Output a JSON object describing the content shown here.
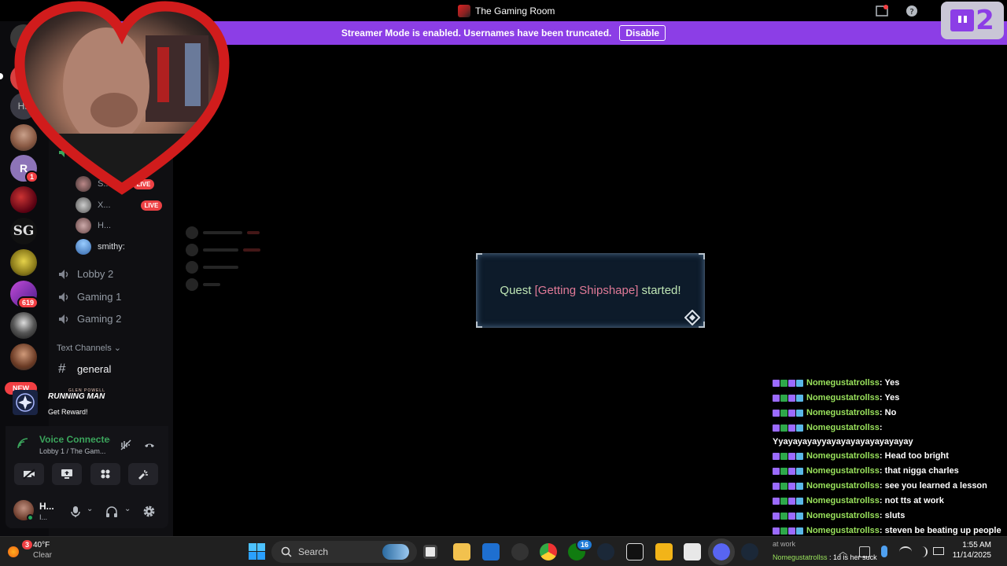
{
  "window": {
    "title": "The Gaming Room"
  },
  "banner": {
    "text": "Streamer Mode is enabled. Usernames have been truncated.",
    "button": "Disable"
  },
  "twitch_badge": {
    "count": "2"
  },
  "guilds": [
    {
      "label": "Hs",
      "icon": "guild-initials"
    },
    {
      "label": "1",
      "icon": "guild-r"
    },
    {
      "label": "SG",
      "icon": "guild-sg"
    },
    {
      "label": "619",
      "icon": "guild-619"
    },
    {
      "label": "NEW",
      "icon": "new-badge"
    }
  ],
  "voice_users": [
    {
      "name": "S...",
      "live": "LIVE"
    },
    {
      "name": "X...",
      "live": "LIVE"
    },
    {
      "name": "H..."
    },
    {
      "name": "smithy:"
    }
  ],
  "channels": {
    "voice": [
      "Lobby 2",
      "Gaming 1",
      "Gaming 2"
    ],
    "text_category": "Text Channels",
    "text": [
      "general"
    ]
  },
  "promo": {
    "title": "RUNNING MAN",
    "subtitle": "GLEN POWELL",
    "cta": "Get Reward!"
  },
  "voice_panel": {
    "status": "Voice Connected",
    "location": "Lobby 1 / The Gam..."
  },
  "user_panel": {
    "name": "H...",
    "status": "I..."
  },
  "quest": {
    "prefix": "Quest ",
    "name": "[Getting Shipshape]",
    "suffix": " started!"
  },
  "chat": {
    "messages": [
      {
        "user": "Nomegustatrollss",
        "text": " : Yes"
      },
      {
        "user": "Nomegustatrollss",
        "text": " : Yes"
      },
      {
        "user": "Nomegustatrollss",
        "text": " : No"
      },
      {
        "user": "Nomegustatrollss",
        "text": " :",
        "cont": "Yyayayayayyayayayayayayayayay"
      },
      {
        "user": "Nomegustatrollss",
        "text": " : Head too bright"
      },
      {
        "user": "Nomegustatrollss",
        "text": " : that nigga charles"
      },
      {
        "user": "Nomegustatrollss",
        "text": " : see you learned a lesson"
      },
      {
        "user": "Nomegustatrollss",
        "text": " : not tts at work"
      },
      {
        "user": "Nomegustatrollss",
        "text": " : sluts"
      },
      {
        "user": "Nomegustatrollss",
        "text": " : steven be beating up people"
      }
    ],
    "overflow_text": "at work",
    "overflow_user": "Nomegustatrollss",
    "overflow_msg": ": 1d is her suck"
  },
  "taskbar": {
    "weather_temp": "40°F",
    "weather_desc": "Clear",
    "weather_badge": "3",
    "search_placeholder": "Search",
    "time": "1:55 AM",
    "date": "11/14/2025",
    "xbox_badge": "16"
  }
}
